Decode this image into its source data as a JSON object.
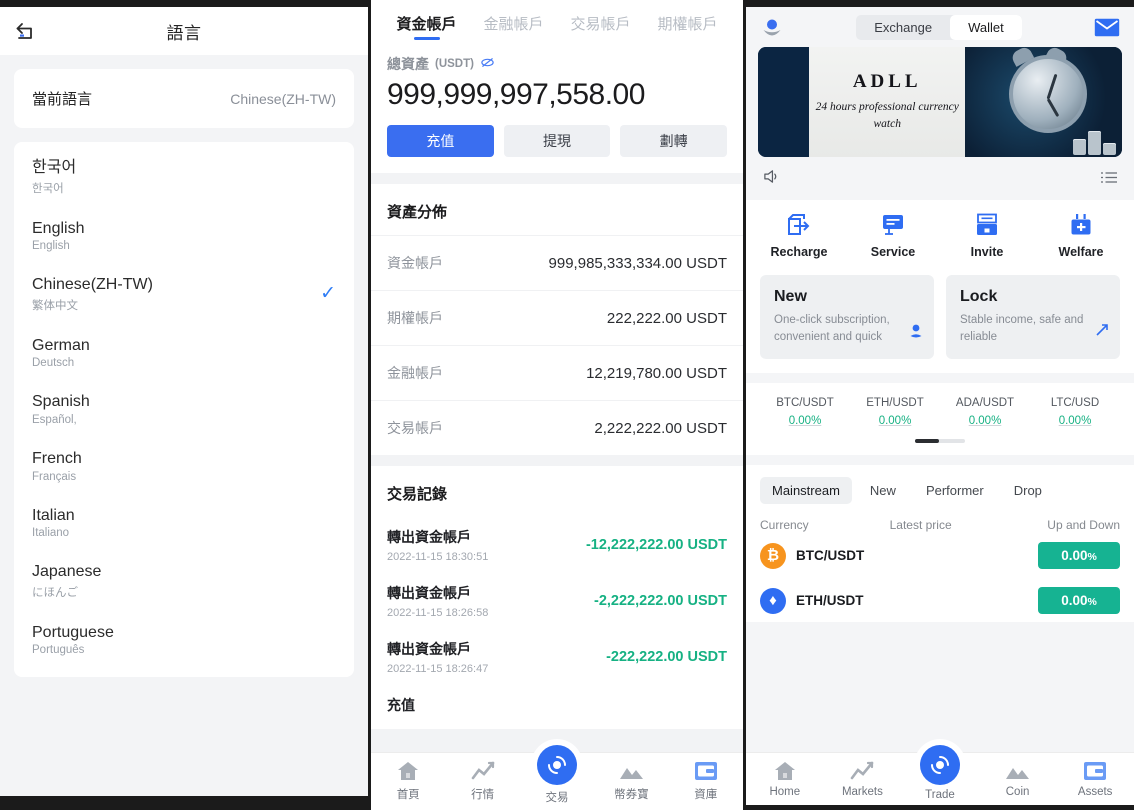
{
  "panel1": {
    "header": {
      "title": "語言",
      "back_icon": "arrow-return-left-icon"
    },
    "current": {
      "label": "當前語言",
      "value": "Chinese(ZH-TW)"
    },
    "languages": [
      {
        "name": "한국어",
        "native": "한국어",
        "selected": false
      },
      {
        "name": "English",
        "native": "English",
        "selected": false
      },
      {
        "name": "Chinese(ZH-TW)",
        "native": "繁体中文",
        "selected": true
      },
      {
        "name": "German",
        "native": "Deutsch",
        "selected": false
      },
      {
        "name": "Spanish",
        "native": "Español,",
        "selected": false
      },
      {
        "name": "French",
        "native": "Français",
        "selected": false
      },
      {
        "name": "Italian",
        "native": "Italiano",
        "selected": false
      },
      {
        "name": "Japanese",
        "native": "にほんご",
        "selected": false
      },
      {
        "name": "Portuguese",
        "native": "Português",
        "selected": false
      }
    ],
    "check_glyph": "✓"
  },
  "panel2": {
    "tabs": [
      {
        "label": "資金帳戶",
        "active": true
      },
      {
        "label": "金融帳戶",
        "active": false
      },
      {
        "label": "交易帳戶",
        "active": false
      },
      {
        "label": "期權帳戶",
        "active": false
      }
    ],
    "balance": {
      "label": "總資產",
      "unit": "(USDT)",
      "eye_icon": "eye-off-icon",
      "amount": "999,999,997,558.00",
      "actions": [
        {
          "label": "充值",
          "primary": true
        },
        {
          "label": "提現",
          "primary": false
        },
        {
          "label": "劃轉",
          "primary": false
        }
      ]
    },
    "distribution": {
      "title": "資產分佈",
      "rows": [
        {
          "name": "資金帳戶",
          "value": "999,985,333,334.00 USDT"
        },
        {
          "name": "期權帳戶",
          "value": "222,222.00 USDT"
        },
        {
          "name": "金融帳戶",
          "value": "12,219,780.00 USDT"
        },
        {
          "name": "交易帳戶",
          "value": "2,222,222.00 USDT"
        }
      ]
    },
    "transactions": {
      "title": "交易記錄",
      "rows": [
        {
          "name": "轉出資金帳戶",
          "date": "2022-11-15 18:30:51",
          "amount": "-12,222,222.00 USDT"
        },
        {
          "name": "轉出資金帳戶",
          "date": "2022-11-15 18:26:58",
          "amount": "-2,222,222.00 USDT"
        },
        {
          "name": "轉出資金帳戶",
          "date": "2022-11-15 18:26:47",
          "amount": "-222,222.00 USDT"
        },
        {
          "name": "充值",
          "date": "",
          "amount": ""
        }
      ]
    },
    "tabbar": [
      {
        "label": "首頁",
        "icon": "home-icon",
        "center": false
      },
      {
        "label": "行情",
        "icon": "chart-icon",
        "center": false
      },
      {
        "label": "交易",
        "icon": "trade-icon",
        "center": true
      },
      {
        "label": "幣券寶",
        "icon": "mountain-icon",
        "center": false
      },
      {
        "label": "資庫",
        "icon": "wallet-icon",
        "center": false
      }
    ]
  },
  "panel3": {
    "header": {
      "avatar_icon": "user-avatar-icon",
      "mail_icon": "envelope-icon",
      "segments": [
        {
          "label": "Exchange",
          "active": false
        },
        {
          "label": "Wallet",
          "active": true
        }
      ]
    },
    "banner": {
      "brand": "ADLL",
      "subtitle": "24 hours professional currency watch",
      "image_alt": "alarm-clock-and-coins"
    },
    "notice": {
      "speaker_icon": "speaker-icon",
      "menu_icon": "list-icon"
    },
    "quick_actions": [
      {
        "label": "Recharge",
        "icon": "recharge-icon"
      },
      {
        "label": "Service",
        "icon": "service-chat-icon"
      },
      {
        "label": "Invite",
        "icon": "invite-inbox-icon"
      },
      {
        "label": "Welfare",
        "icon": "welfare-gift-icon"
      }
    ],
    "promos": [
      {
        "title": "New",
        "desc": "One-click subscription, convenient and quick",
        "icon": "new-badge-icon"
      },
      {
        "title": "Lock",
        "desc": "Stable income, safe and reliable",
        "icon": "lock-arrow-icon"
      }
    ],
    "tickers": [
      {
        "pair": "BTC/USDT",
        "change": "0.00%"
      },
      {
        "pair": "ETH/USDT",
        "change": "0.00%"
      },
      {
        "pair": "ADA/USDT",
        "change": "0.00%"
      },
      {
        "pair": "LTC/USD",
        "change": "0.00%"
      }
    ],
    "market": {
      "tabs": [
        {
          "label": "Mainstream",
          "active": true
        },
        {
          "label": "New",
          "active": false
        },
        {
          "label": "Performer",
          "active": false
        },
        {
          "label": "Drop",
          "active": false
        }
      ],
      "columns": [
        "Currency",
        "Latest price",
        "Up and Down"
      ],
      "rows": [
        {
          "pair": "BTC/USDT",
          "price": "",
          "change": "0.00",
          "change_unit": "%",
          "symbol": "₿",
          "color": "#f7941e"
        },
        {
          "pair": "ETH/USDT",
          "price": "",
          "change": "0.00",
          "change_unit": "%",
          "symbol": "♦",
          "color": "#2f6df2"
        }
      ]
    },
    "tabbar": [
      {
        "label": "Home",
        "icon": "home-icon",
        "center": false
      },
      {
        "label": "Markets",
        "icon": "chart-icon",
        "center": false
      },
      {
        "label": "Trade",
        "icon": "trade-icon",
        "center": true
      },
      {
        "label": "Coin",
        "icon": "mountain-icon",
        "center": false
      },
      {
        "label": "Assets",
        "icon": "wallet-icon",
        "center": false
      }
    ]
  },
  "colors": {
    "accent_blue": "#3a6ef0",
    "green": "#16b392",
    "bg_gray": "#f2f3f5",
    "text_dark": "#1b1b1d",
    "text_muted": "#8e939b"
  }
}
